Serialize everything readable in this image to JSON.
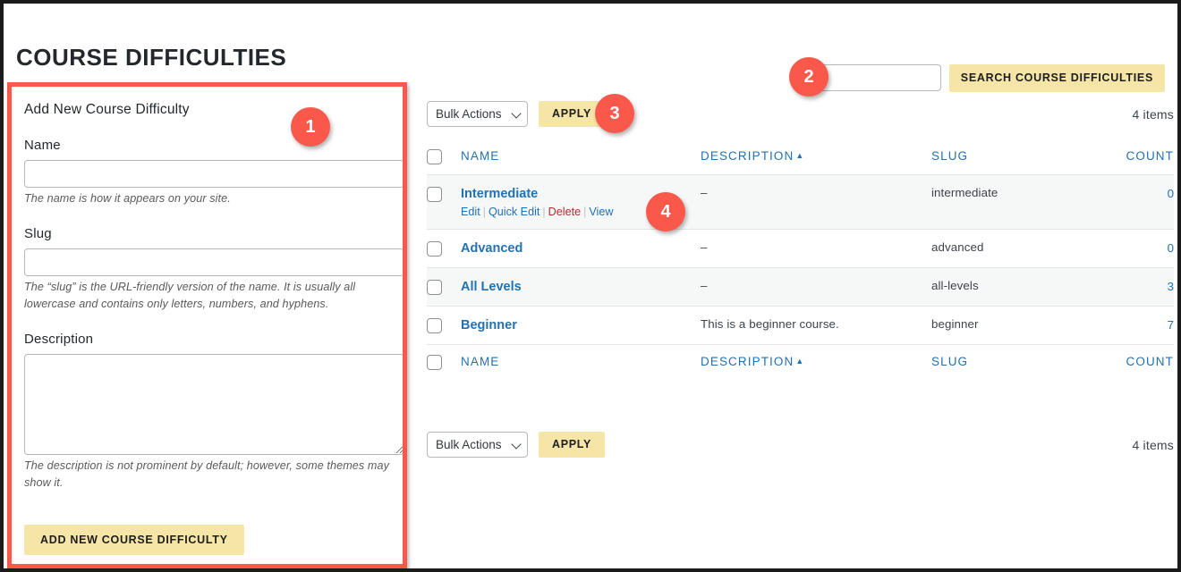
{
  "page": {
    "title": "COURSE DIFFICULTIES"
  },
  "form": {
    "heading": "Add New Course Difficulty",
    "name_label": "Name",
    "name_value": "",
    "name_help": "The name is how it appears on your site.",
    "slug_label": "Slug",
    "slug_value": "",
    "slug_help": "The “slug” is the URL-friendly version of the name. It is usually all lowercase and contains only letters, numbers, and hyphens.",
    "description_label": "Description",
    "description_value": "",
    "description_help": "The description is not prominent by default; however, some themes may show it.",
    "submit_label": "ADD NEW COURSE DIFFICULTY"
  },
  "search": {
    "value": "",
    "placeholder": "",
    "button_label": "SEARCH COURSE DIFFICULTIES"
  },
  "tablenav_top": {
    "bulk_label": "Bulk Actions",
    "apply_label": "APPLY",
    "items_count": "4 items"
  },
  "tablenav_bottom": {
    "bulk_label": "Bulk Actions",
    "apply_label": "APPLY",
    "items_count": "4 items"
  },
  "table": {
    "columns": {
      "name": "NAME",
      "description": "DESCRIPTION",
      "slug": "SLUG",
      "count": "COUNT"
    },
    "sort_indicator": "▲",
    "sorted_by": "description",
    "rows": [
      {
        "name": "Intermediate",
        "description": "–",
        "slug": "intermediate",
        "count": "0",
        "actions": {
          "edit": "Edit",
          "quick_edit": "Quick Edit",
          "delete": "Delete",
          "view": "View"
        }
      },
      {
        "name": "Advanced",
        "description": "–",
        "slug": "advanced",
        "count": "0"
      },
      {
        "name": "All Levels",
        "description": "–",
        "slug": "all-levels",
        "count": "3"
      },
      {
        "name": "Beginner",
        "description": "This is a beginner course.",
        "slug": "beginner",
        "count": "7"
      }
    ]
  },
  "callouts": [
    {
      "number": "1"
    },
    {
      "number": "2"
    },
    {
      "number": "3"
    },
    {
      "number": "4"
    }
  ],
  "colors": {
    "highlight": "#f9584a",
    "button_yellow": "#f5e6a8",
    "link_blue": "#2271b1",
    "delete_red": "#b32d2e",
    "row_alt": "#f6f7f7"
  }
}
